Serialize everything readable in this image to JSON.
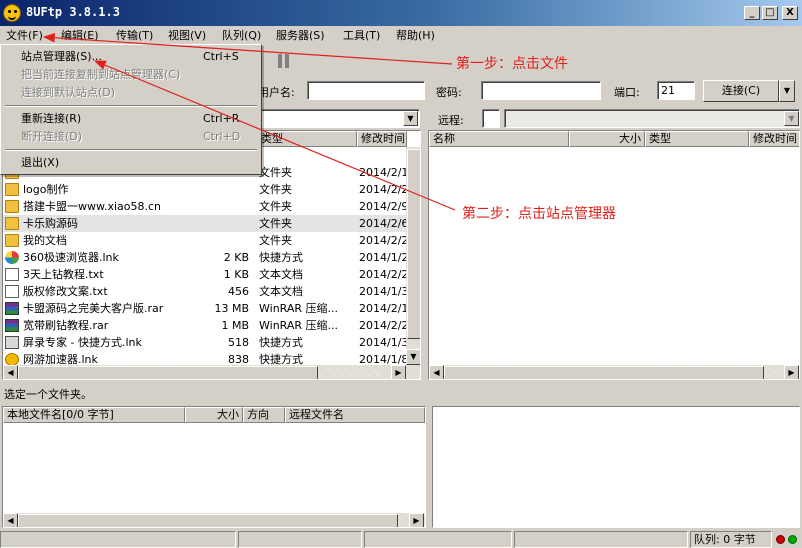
{
  "window": {
    "title": "8UFtp 3.8.1.3",
    "min_label": "_",
    "max_label": "□",
    "close_label": "X"
  },
  "menu": [
    "文件(F)",
    "编辑(E)",
    "传输(T)",
    "视图(V)",
    "队列(Q)",
    "服务器(S)",
    "工具(T)",
    "帮助(H)"
  ],
  "file_menu": {
    "site_manager": "站点管理器(S)...",
    "site_manager_shortcut": "Ctrl+S",
    "copy_to_site_manager": "把当前连接复制到站点管理器(C)",
    "connect_default": "连接到默认站点(D)",
    "reconnect": "重新连接(R)",
    "reconnect_shortcut": "Ctrl+R",
    "disconnect": "断开连接(D)",
    "disconnect_shortcut": "Ctrl+D",
    "exit": "退出(X)"
  },
  "connection": {
    "user_label": "用户名:",
    "password_label": "密码:",
    "port_label": "端口:",
    "port_value": "21",
    "connect_button": "连接(C)"
  },
  "local": {
    "columns": [
      "类型",
      "修改时间"
    ],
    "files": [
      {
        "name": "",
        "size": "",
        "type": "文件夹",
        "date": "2014/2/1",
        "icon": "folder"
      },
      {
        "name": "logo制作",
        "size": "",
        "type": "文件夹",
        "date": "2014/2/2",
        "icon": "folder"
      },
      {
        "name": "搭建卡盟一www.xiao58.cn",
        "size": "",
        "type": "文件夹",
        "date": "2014/2/9",
        "icon": "folder"
      },
      {
        "name": "卡乐购源码",
        "size": "",
        "type": "文件夹",
        "date": "2014/2/6",
        "icon": "folder"
      },
      {
        "name": "我的文档",
        "size": "",
        "type": "文件夹",
        "date": "2014/2/2",
        "icon": "folder"
      },
      {
        "name": "360极速浏览器.lnk",
        "size": "2 KB",
        "type": "快捷方式",
        "date": "2014/1/2",
        "icon": "browser"
      },
      {
        "name": "3天上钻教程.txt",
        "size": "1 KB",
        "type": "文本文档",
        "date": "2014/2/2",
        "icon": "file"
      },
      {
        "name": "版权修改文案.txt",
        "size": "456",
        "type": "文本文档",
        "date": "2014/1/3",
        "icon": "file"
      },
      {
        "name": "卡盟源码之完美大客户版.rar",
        "size": "13 MB",
        "type": "WinRAR 压缩...",
        "date": "2014/2/1",
        "icon": "rar"
      },
      {
        "name": "宽带刷钻教程.rar",
        "size": "1 MB",
        "type": "WinRAR 压缩...",
        "date": "2014/2/2",
        "icon": "rar"
      },
      {
        "name": "屏录专家 - 快捷方式.lnk",
        "size": "518",
        "type": "快捷方式",
        "date": "2014/1/3",
        "icon": "lnk"
      },
      {
        "name": "网游加速器.lnk",
        "size": "838",
        "type": "快捷方式",
        "date": "2014/1/8",
        "icon": "game"
      }
    ],
    "status": "选定一个文件夹。"
  },
  "remote": {
    "label": "远程:",
    "columns": [
      "名称",
      "大小",
      "类型",
      "修改时间"
    ]
  },
  "queue": {
    "columns": [
      "本地文件名[0/0 字节]",
      "大小",
      "方向",
      "远程文件名"
    ]
  },
  "statusbar": {
    "queue": "队列: 0 字节"
  },
  "annotations": {
    "step1": "第一步：点击文件",
    "step2": "第二步：点击站点管理器"
  },
  "colors": {
    "accent": "#e0201c",
    "title_start": "#0a246a",
    "title_end": "#a6caf0"
  }
}
